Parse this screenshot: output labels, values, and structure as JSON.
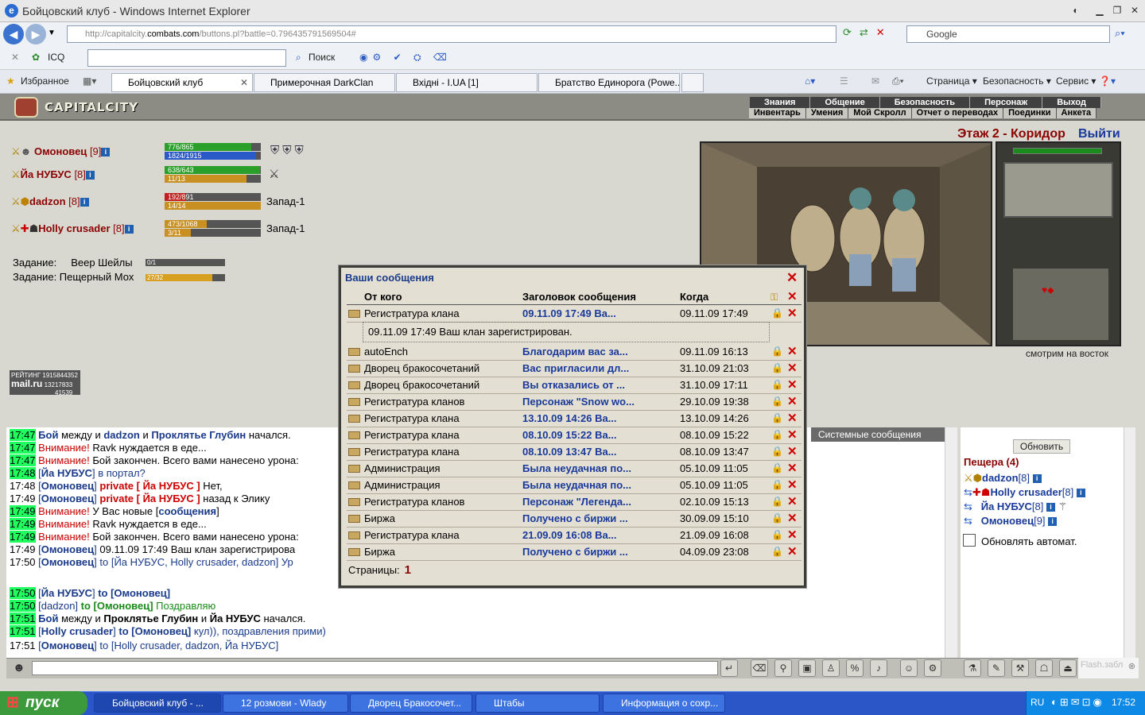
{
  "window": {
    "title": "Бойцовский клуб - Windows Internet Explorer"
  },
  "address": {
    "url_prefix": "http://capitalcity.",
    "url_domain": "combats.com",
    "url_suffix": "/buttons.pl?battle=0.796435791569504#",
    "search_placeholder": "Google"
  },
  "toolbar": {
    "icq": "ICQ",
    "search": "Поиск"
  },
  "tabs": {
    "favorites": "Избранное",
    "items": [
      "Бойцовский клуб",
      "Примерочная DarkClan",
      "Вхідні - I.UA [1]",
      "Братство Единорога (Powe..."
    ]
  },
  "ie_cmds": {
    "page": "Страница",
    "safety": "Безопасность",
    "service": "Сервис"
  },
  "game": {
    "logo": "CAPITALCITY",
    "menu_top": [
      "Знания",
      "Общение",
      "Безопасность",
      "Персонаж",
      "Выход"
    ],
    "menu_bottom": [
      "Инвентарь",
      "Умения",
      "Мой Скролл",
      "Отчет о переводах",
      "Поединки",
      "Анкета"
    ],
    "floor": "Этаж 2 - Коридор",
    "exit": "Выйти",
    "look": "смотрим на восток",
    "players": [
      {
        "name": "Омоновец",
        "level": "[9]",
        "hp": "776/865",
        "mp": "1824/1915",
        "hp_frac": 0.9,
        "mp_frac": 0.95,
        "loc": ""
      },
      {
        "name": "Йа НУБУС",
        "level": "[8]",
        "hp": "638/643",
        "mp": "11/13",
        "hp_frac": 0.99,
        "mp_frac": 0.85,
        "loc": ""
      },
      {
        "name": "dadzon",
        "level": "[8]",
        "hp": "192/891",
        "mp": "14/14",
        "hp_frac": 0.22,
        "mp_frac": 1.0,
        "loc": "Запад-1"
      },
      {
        "name": "Holly crusader",
        "level": "[8]",
        "hp": "473/1068",
        "mp": "3/11",
        "hp_frac": 0.44,
        "mp_frac": 0.27,
        "loc": "Запад-1"
      }
    ],
    "tasks": [
      {
        "label": "Задание:",
        "name": "Веер Шейлы",
        "progress": "0/1",
        "frac": 0.0
      },
      {
        "label": "Задание: Пещерный Мох",
        "name": "",
        "progress": "27/32",
        "frac": 0.84
      }
    ],
    "mailru": {
      "label": "РЕЙТИНГ",
      "n1": "1915844352",
      "brand": "mail.ru",
      "n2": "13217833",
      "n3": "41539"
    }
  },
  "chat": {
    "tab": "Системные сообщения",
    "lines": [
      {
        "t": "17:47",
        "hl": true,
        "html": "<b style='color:#1a3a8a'>Бой</b> между и <b style='color:#1a3a8a'>dadzon</b> и <b style='color:#1a3a8a'>Проклятье Глубин</b> начался."
      },
      {
        "t": "17:47",
        "hl": true,
        "html": "<span style='color:#c00'>Внимание!</span> Ravk нуждается в еде..."
      },
      {
        "t": "17:47",
        "hl": true,
        "html": "<span style='color:#c00'>Внимание!</span> Бой закончен. Всего вами нанесено урона:"
      },
      {
        "t": "17:48",
        "hl": true,
        "html": "<span style='color:#1a3a8a'>[<b>Йа НУБУС</b>]</span> <span style='color:#1a3a8a'>в портал?</span>"
      },
      {
        "t": "17:48",
        "hl": false,
        "html": "<span style='color:#1a3a8a'>[<b>Омоновец</b>]</span> <b style='color:#c00'>private [ Йа НУБУС ]</b> Нет,"
      },
      {
        "t": "17:49",
        "hl": false,
        "html": "<span style='color:#1a3a8a'>[<b>Омоновец</b>]</span> <b style='color:#c00'>private [ Йа НУБУС ]</b> назад к Элику"
      },
      {
        "t": "17:49",
        "hl": true,
        "html": "<span style='color:#c00'>Внимание!</span> У Вас новые [<b style='color:#1a3a8a'>сообщения</b>]"
      },
      {
        "t": "17:49",
        "hl": true,
        "html": "<span style='color:#c00'>Внимание!</span> Ravk нуждается в еде..."
      },
      {
        "t": "17:49",
        "hl": true,
        "html": "<span style='color:#c00'>Внимание!</span> Бой закончен. Всего вами нанесено урона:"
      },
      {
        "t": "17:49",
        "hl": false,
        "html": "<span style='color:#1a3a8a'>[<b>Омоновец</b>]</span> 09.11.09 17:49 Ваш клан зарегистрирова"
      },
      {
        "t": "17:50",
        "hl": false,
        "html": "<span style='color:#1a3a8a'>[<b>Омоновец</b>]</span> <span style='color:#1a3a8a'>to [Йа НУБУС, Holly crusader, dadzon] Ур</span>"
      },
      {
        "t": "17:50",
        "hl": true,
        "html": "<span style='color:#1a3a8a'>[<b>Йа НУБУС</b>]</span> <b style='color:#1a3a8a'>to [Омоновец]</b>"
      },
      {
        "t": "17:50",
        "hl": true,
        "html": "<span style='color:#1a3a8a'>[dadzon]</span> <b style='color:#1a8a1a'>to [Омоновец]</b> <span style='color:#1a8a1a'>Поздравляю</span>"
      },
      {
        "t": "17:51",
        "hl": true,
        "html": "<b style='color:#1a3a8a'>Бой</b> между и <b>Проклятье Глубин</b> и <b>Йа НУБУС</b> начался."
      },
      {
        "t": "17:51",
        "hl": true,
        "html": "<span style='color:#1a3a8a'>[<b>Holly crusader</b>]</span> <b style='color:#1a3a8a'>to [Омоновец]</b> <span style='color:#1a3a8a'>кул)), поздравления прими)</span>"
      },
      {
        "t": "17:51",
        "hl": false,
        "html": "<span style='color:#1a3a8a'>[<b>Омоновец</b>]</span> <span style='color:#1a3a8a'>to [Holly crusader, dadzon, Йа НУБУС]</span>"
      }
    ]
  },
  "right": {
    "refresh": "Обновить",
    "cave": "Пещера (4)",
    "members": [
      {
        "name": "dadzon",
        "level": "[8]"
      },
      {
        "name": "Holly crusader",
        "level": "[8]"
      },
      {
        "name": "Йа НУБУС",
        "level": "[8]"
      },
      {
        "name": "Омоновец",
        "level": "[9]"
      }
    ],
    "auto": "Обновлять автомат."
  },
  "dialog": {
    "title": "Ваши сообщения",
    "col_from": "От кого",
    "col_subject": "Заголовок сообщения",
    "col_when": "Когда",
    "body": "09.11.09 17:49 Ваш клан зарегистрирован.",
    "pages_label": "Страницы:",
    "page": "1",
    "rows": [
      {
        "from": "Регистратура клана",
        "subject": "09.11.09 17:49 Ва...",
        "when": "09.11.09 17:49"
      },
      {
        "from": "autoEnch",
        "subject": "Благодарим вас за...",
        "when": "09.11.09 16:13"
      },
      {
        "from": "Дворец бракосочетаний",
        "subject": "Вас пригласили дл...",
        "when": "31.10.09 21:03"
      },
      {
        "from": "Дворец бракосочетаний",
        "subject": "Вы отказались от ...",
        "when": "31.10.09 17:11"
      },
      {
        "from": "Регистратура кланов",
        "subject": "Персонаж \"Snow wo...",
        "when": "29.10.09 19:38"
      },
      {
        "from": "Регистратура клана",
        "subject": "13.10.09 14:26 Ва...",
        "when": "13.10.09 14:26"
      },
      {
        "from": "Регистратура клана",
        "subject": "08.10.09 15:22 Ва...",
        "when": "08.10.09 15:22"
      },
      {
        "from": "Регистратура клана",
        "subject": "08.10.09 13:47 Ва...",
        "when": "08.10.09 13:47"
      },
      {
        "from": "Администрация",
        "subject": "Была неудачная по...",
        "when": "05.10.09 11:05"
      },
      {
        "from": "Администрация",
        "subject": "Была неудачная по...",
        "when": "05.10.09 11:05"
      },
      {
        "from": "Регистратура кланов",
        "subject": "Персонаж \"Легенда...",
        "when": "02.10.09 15:13"
      },
      {
        "from": "Биржа",
        "subject": "Получено с биржи ...",
        "when": "30.09.09 15:10"
      },
      {
        "from": "Регистратура клана",
        "subject": "21.09.09 16:08 Ва...",
        "when": "21.09.09 16:08"
      },
      {
        "from": "Биржа",
        "subject": "Получено с биржи ...",
        "when": "04.09.09 23:08"
      }
    ]
  },
  "flash": "Flash.забл",
  "taskbar": {
    "start": "пуск",
    "items": [
      "Бойцовский клуб - ...",
      "12 розмови - Wlady",
      "Дворец Бракосочет...",
      "Штабы",
      "Информация о сохр..."
    ],
    "lang": "RU",
    "clock": "17:52"
  }
}
